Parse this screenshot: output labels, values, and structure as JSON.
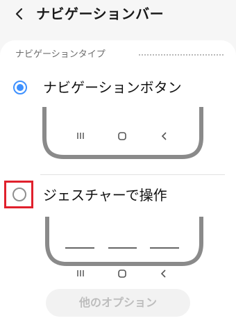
{
  "header": {
    "back_icon": "chevron-left-icon",
    "title": "ナビゲーションバー"
  },
  "section": {
    "label": "ナビゲーションタイプ"
  },
  "options": [
    {
      "label": "ナビゲーションボタン",
      "selected": true
    },
    {
      "label": "ジェスチャーで操作",
      "selected": false
    }
  ],
  "nav_preview_icons": [
    "recent-apps-icon",
    "home-icon",
    "back-icon"
  ],
  "footer": {
    "other_options_label": "他のオプション"
  },
  "colors": {
    "accent": "#3e91ff",
    "highlight": "#e0202c"
  }
}
